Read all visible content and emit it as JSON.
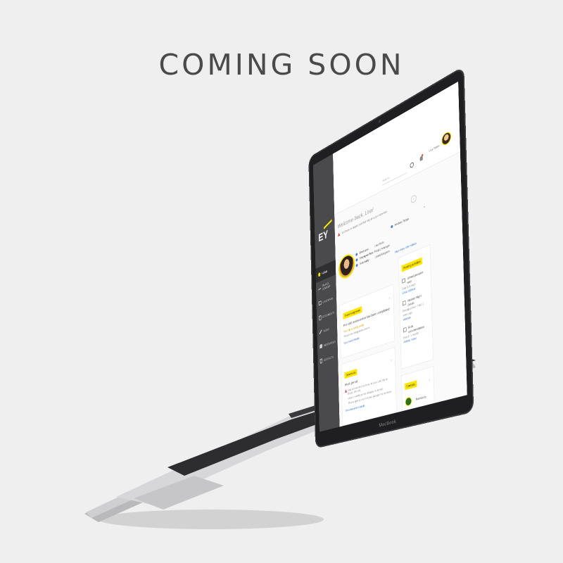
{
  "headline": "COMING SOON",
  "device_brand": "MacBook",
  "app": {
    "logo": "EY",
    "brand_color": "#ffe600",
    "sidebar": {
      "items": [
        {
          "label": "HOME",
          "icon": "home-icon",
          "active": true
        },
        {
          "label": "TRAVEL ADVISER",
          "icon": "plane-icon",
          "active": false
        },
        {
          "label": "CALENDAR",
          "icon": "calendar-icon",
          "active": false
        },
        {
          "label": "DOCUMENTS",
          "icon": "document-icon",
          "active": false
        },
        {
          "label": "TASKS",
          "icon": "pen-icon",
          "active": false
        },
        {
          "label": "RESOURCES",
          "icon": "hand-icon",
          "active": false
        },
        {
          "label": "CONTACTS",
          "icon": "phone-icon",
          "active": false
        }
      ]
    },
    "topbar": {
      "search_placeholder": "Search...",
      "user_name": "Lisa Wells"
    },
    "welcome": "Welcome back, Lisa!",
    "alert_text": "You have an urgent task that requires your attention",
    "adviser_label": "Adviser: Tonya",
    "profile": {
      "rows": [
        {
          "label": "Employee",
          "value": "Lisa Wells"
        },
        {
          "label": "Employee Role",
          "value": "Project Manager"
        },
        {
          "label": "Nationality",
          "value": "United Kingdom"
        }
      ],
      "more_link": "View more information"
    },
    "card_assignment": {
      "tag": "Travel assignment",
      "title": "Pre-visit assessment has been completed",
      "status": "Your trip is nearly ready",
      "note": "Please see integration actions",
      "link": "View travel details"
    },
    "card_documents": {
      "tag": "Documents",
      "title": "Work permit",
      "note": "You are not able to move for your start trip to Brazil. We will",
      "note2": "collect a work permit officially on arrival.",
      "note3": "Please upload proof of your passport to continue",
      "link": "View document details"
    },
    "card_pending": {
      "tag": "Pending activities",
      "items": [
        {
          "title": "Upload passport scan",
          "meta": "Due in 3 days",
          "link": "Email Adviser"
        },
        {
          "title": "Validate Flight Details",
          "meta": "Provided from TMG 1 week ago",
          "link": "Validate"
        },
        {
          "title": "Book accommodation",
          "meta": "Due in 1 month",
          "link": "Airbnb, Hotel"
        }
      ]
    },
    "card_contacts": {
      "tag": "Contacts",
      "name": "Nomfundo Mbune"
    }
  }
}
